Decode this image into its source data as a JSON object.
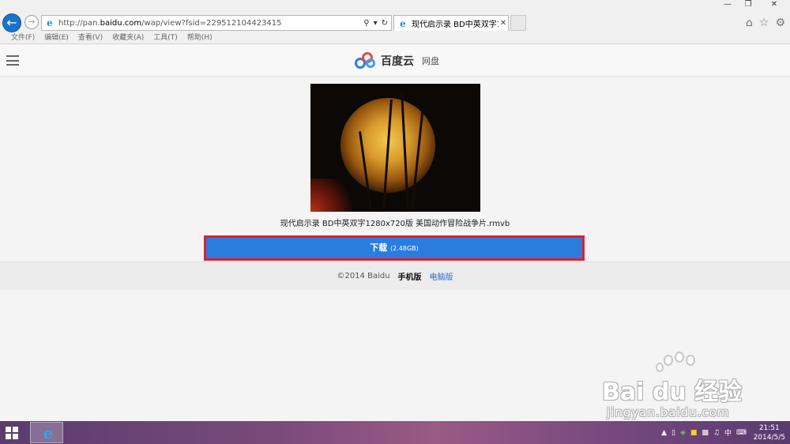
{
  "browser": {
    "url_prefix": "http://pan.",
    "url_domain": "baidu.com",
    "url_path": "/wap/view?fsid=229512104423415",
    "tab_title": "现代启示录 BD中英双字12...",
    "menu": [
      "文件(F)",
      "编辑(E)",
      "查看(V)",
      "收藏夹(A)",
      "工具(T)",
      "帮助(H)"
    ]
  },
  "site": {
    "logo_text": "百度云",
    "logo_sub": "网盘"
  },
  "file": {
    "name": "现代启示录 BD中英双字1280x720版 美国动作冒险战争片.rmvb",
    "download_label": "下载",
    "download_size": "(2.48GB)"
  },
  "footer": {
    "copyright": "©2014 Baidu",
    "mobile": "手机版",
    "pc": "电脑版"
  },
  "watermark": {
    "text": "Bai du 经验",
    "url": "jingyan.baidu.com"
  },
  "taskbar": {
    "ime": "中",
    "time": "21:51",
    "date": "2014/5/5"
  },
  "colors": {
    "download_button": "#2a7ddd",
    "highlight_border": "#e0202a",
    "link_blue": "#2a68c8",
    "ie_blue": "#1a73c8"
  }
}
